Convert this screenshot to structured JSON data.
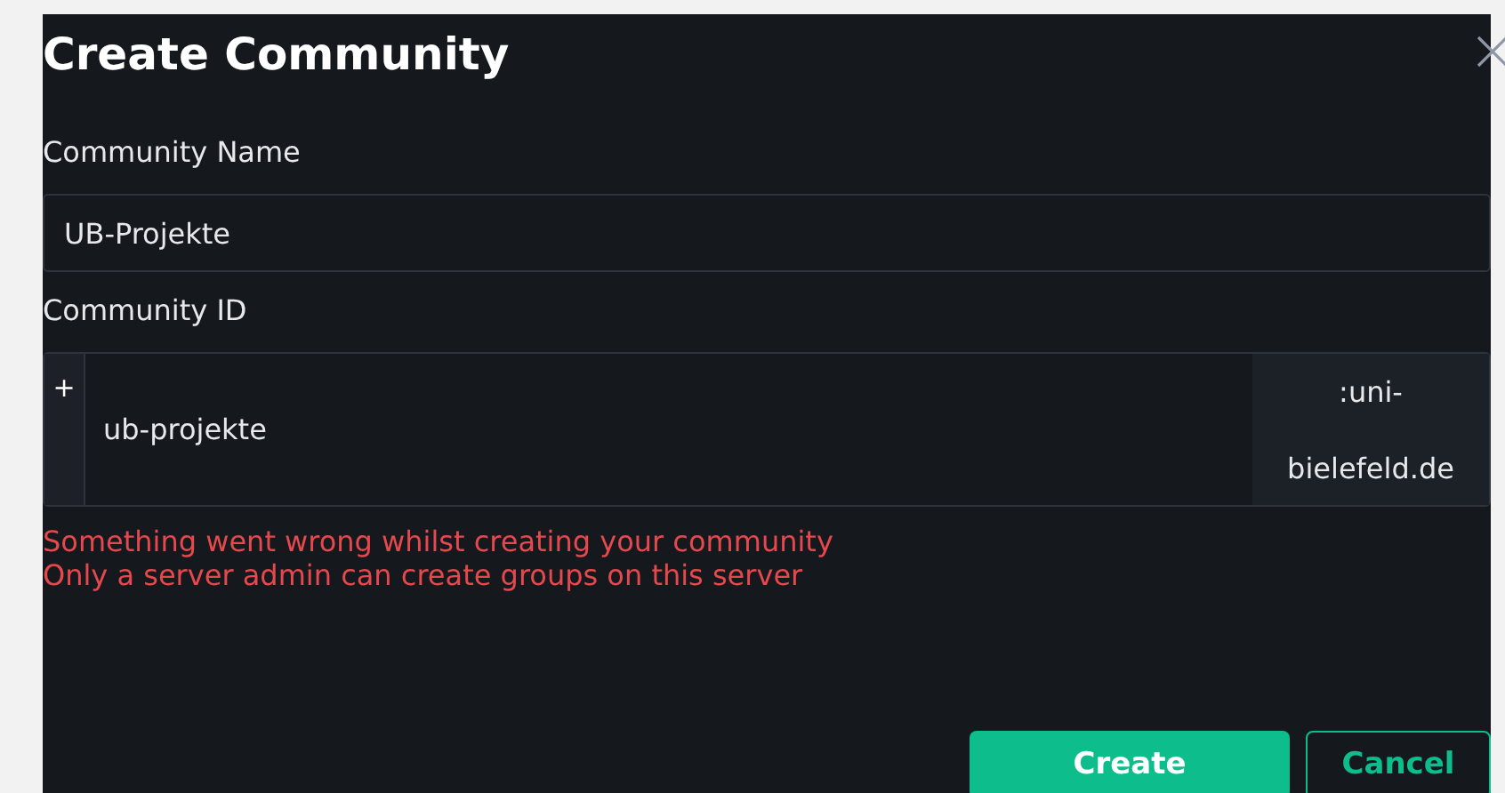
{
  "dialog": {
    "title": "Create Community",
    "fields": [
      {
        "label": "Community Name",
        "value": "UB-Projekte"
      },
      {
        "label": "Community ID",
        "prefix": "+",
        "value": "ub-projekte",
        "suffix": ":uni-bielefeld.de"
      }
    ],
    "errors": [
      "Something went wrong whilst creating your community",
      "Only a server admin can create groups on this server"
    ],
    "buttons": [
      {
        "label": "Create",
        "kind": "primary"
      },
      {
        "label": "Cancel",
        "kind": "secondary"
      }
    ]
  }
}
